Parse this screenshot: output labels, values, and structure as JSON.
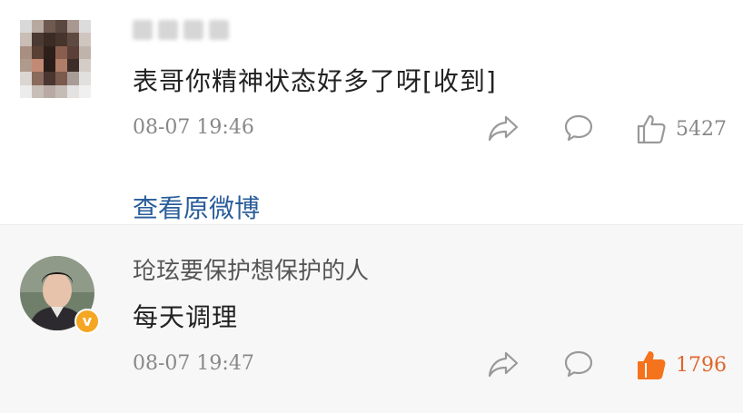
{
  "comments": [
    {
      "username": "",
      "text": "表哥你精神状态好多了呀[收到]",
      "timestamp": "08-07 19:46",
      "like_count": "5427",
      "liked": false
    },
    {
      "username": "玱玹要保护想保护的人",
      "text": "每天调理",
      "timestamp": "08-07 19:47",
      "like_count": "1796",
      "liked": true,
      "verified": true
    }
  ],
  "view_original_label": "查看原微博",
  "colors": {
    "icon_gray": "#999999",
    "liked_orange": "#f5731c",
    "like_count_liked": "#e0652b",
    "like_count_default": "#888888",
    "link_blue": "#2a5d9a",
    "verified_badge": "#f5a623"
  },
  "icons": {
    "share": "share-arrow-icon",
    "reply": "comment-bubble-icon",
    "like": "thumbs-up-icon",
    "verified": "verified-v-icon"
  }
}
